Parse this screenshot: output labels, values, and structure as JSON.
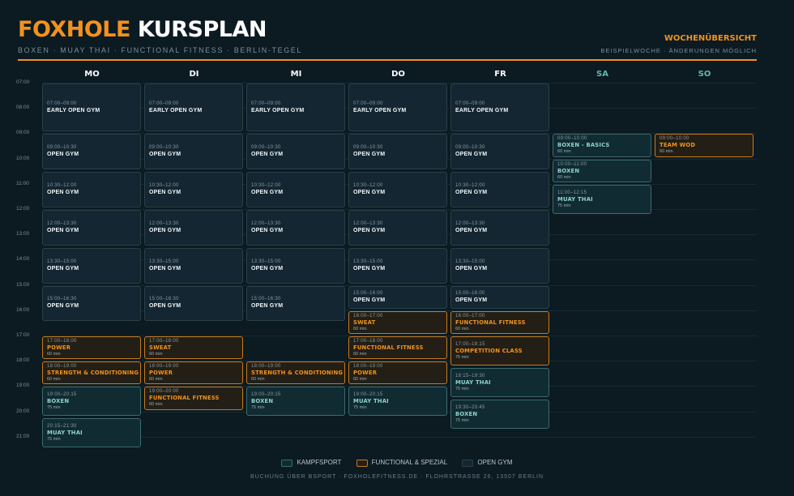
{
  "header": {
    "brand": "FOXHOLE",
    "title": "KURSPLAN",
    "subtitle": "BOXEN · MUAY THAI · FUNCTIONAL FITNESS · BERLIN-TEGEL",
    "overview": "WOCHENÜBERSICHT",
    "note": "BEISPIELWOCHE · ÄNDERUNGEN MÖGLICH"
  },
  "colors": {
    "accent": "#f2921d",
    "kampfsport": "#3a6c6c",
    "open_gym": "#2a4048",
    "background": "#0c1a22"
  },
  "days": [
    "MO",
    "DI",
    "MI",
    "DO",
    "FR",
    "SA",
    "SO"
  ],
  "times": [
    "07:00",
    "08:00",
    "09:00",
    "10:00",
    "11:00",
    "12:00",
    "13:00",
    "14:00",
    "15:00",
    "16:00",
    "17:00",
    "18:00",
    "19:00",
    "20:00",
    "21:00"
  ],
  "schedule": [
    [
      {
        "time": "07:00–09:00",
        "name": "EARLY OPEN GYM",
        "cat": "open",
        "start": 7,
        "end": 9
      },
      {
        "time": "09:00–10:30",
        "name": "OPEN GYM",
        "cat": "open",
        "start": 9,
        "end": 10.5
      },
      {
        "time": "10:30–12:00",
        "name": "OPEN GYM",
        "cat": "open",
        "start": 10.5,
        "end": 12
      },
      {
        "time": "12:00–13:30",
        "name": "OPEN GYM",
        "cat": "open",
        "start": 12,
        "end": 13.5
      },
      {
        "time": "13:30–15:00",
        "name": "OPEN GYM",
        "cat": "open",
        "start": 13.5,
        "end": 15
      },
      {
        "time": "15:00–16:30",
        "name": "OPEN GYM",
        "cat": "open",
        "start": 15,
        "end": 16.5
      },
      {
        "time": "17:00–18:00",
        "name": "POWER",
        "dur": "60 min",
        "cat": "fun",
        "start": 17,
        "end": 18
      },
      {
        "time": "18:00–19:00",
        "name": "STRENGTH & CONDITIONING",
        "dur": "60 min",
        "cat": "fun",
        "start": 18,
        "end": 19
      },
      {
        "time": "19:00–20:15",
        "name": "BOXEN",
        "dur": "75 min",
        "cat": "kampf",
        "start": 19,
        "end": 20.25
      },
      {
        "time": "20:15–21:30",
        "name": "MUAY THAI",
        "dur": "75 min",
        "cat": "kampf",
        "start": 20.25,
        "end": 21.5
      }
    ],
    [
      {
        "time": "07:00–09:00",
        "name": "EARLY OPEN GYM",
        "cat": "open",
        "start": 7,
        "end": 9
      },
      {
        "time": "09:00–10:30",
        "name": "OPEN GYM",
        "cat": "open",
        "start": 9,
        "end": 10.5
      },
      {
        "time": "10:30–12:00",
        "name": "OPEN GYM",
        "cat": "open",
        "start": 10.5,
        "end": 12
      },
      {
        "time": "12:00–13:30",
        "name": "OPEN GYM",
        "cat": "open",
        "start": 12,
        "end": 13.5
      },
      {
        "time": "13:30–15:00",
        "name": "OPEN GYM",
        "cat": "open",
        "start": 13.5,
        "end": 15
      },
      {
        "time": "15:00–16:30",
        "name": "OPEN GYM",
        "cat": "open",
        "start": 15,
        "end": 16.5
      },
      {
        "time": "17:00–18:00",
        "name": "SWEAT",
        "dur": "60 min",
        "cat": "fun",
        "start": 17,
        "end": 18
      },
      {
        "time": "18:00–19:00",
        "name": "POWER",
        "dur": "60 min",
        "cat": "fun",
        "start": 18,
        "end": 19
      },
      {
        "time": "19:00–20:00",
        "name": "FUNCTIONAL FITNESS",
        "dur": "60 min",
        "cat": "fun",
        "start": 19,
        "end": 20
      }
    ],
    [
      {
        "time": "07:00–09:00",
        "name": "EARLY OPEN GYM",
        "cat": "open",
        "start": 7,
        "end": 9
      },
      {
        "time": "09:00–10:30",
        "name": "OPEN GYM",
        "cat": "open",
        "start": 9,
        "end": 10.5
      },
      {
        "time": "10:30–12:00",
        "name": "OPEN GYM",
        "cat": "open",
        "start": 10.5,
        "end": 12
      },
      {
        "time": "12:00–13:30",
        "name": "OPEN GYM",
        "cat": "open",
        "start": 12,
        "end": 13.5
      },
      {
        "time": "13:30–15:00",
        "name": "OPEN GYM",
        "cat": "open",
        "start": 13.5,
        "end": 15
      },
      {
        "time": "15:00–16:30",
        "name": "OPEN GYM",
        "cat": "open",
        "start": 15,
        "end": 16.5
      },
      {
        "time": "18:00–19:00",
        "name": "STRENGTH & CONDITIONING",
        "dur": "60 min",
        "cat": "fun",
        "start": 18,
        "end": 19
      },
      {
        "time": "19:00–20:15",
        "name": "BOXEN",
        "dur": "75 min",
        "cat": "kampf",
        "start": 19,
        "end": 20.25
      }
    ],
    [
      {
        "time": "07:00–09:00",
        "name": "EARLY OPEN GYM",
        "cat": "open",
        "start": 7,
        "end": 9
      },
      {
        "time": "09:00–10:30",
        "name": "OPEN GYM",
        "cat": "open",
        "start": 9,
        "end": 10.5
      },
      {
        "time": "10:30–12:00",
        "name": "OPEN GYM",
        "cat": "open",
        "start": 10.5,
        "end": 12
      },
      {
        "time": "12:00–13:30",
        "name": "OPEN GYM",
        "cat": "open",
        "start": 12,
        "end": 13.5
      },
      {
        "time": "13:30–15:00",
        "name": "OPEN GYM",
        "cat": "open",
        "start": 13.5,
        "end": 15
      },
      {
        "time": "15:00–16:00",
        "name": "OPEN GYM",
        "cat": "open",
        "start": 15,
        "end": 16
      },
      {
        "time": "16:00–17:00",
        "name": "SWEAT",
        "dur": "60 min",
        "cat": "fun",
        "start": 16,
        "end": 17
      },
      {
        "time": "17:00–18:00",
        "name": "FUNCTIONAL FITNESS",
        "dur": "60 min",
        "cat": "fun",
        "start": 17,
        "end": 18
      },
      {
        "time": "18:00–19:00",
        "name": "POWER",
        "dur": "60 min",
        "cat": "fun",
        "start": 18,
        "end": 19
      },
      {
        "time": "19:00–20:15",
        "name": "MUAY THAI",
        "dur": "75 min",
        "cat": "kampf",
        "start": 19,
        "end": 20.25
      }
    ],
    [
      {
        "time": "07:00–09:00",
        "name": "EARLY OPEN GYM",
        "cat": "open",
        "start": 7,
        "end": 9
      },
      {
        "time": "09:00–10:30",
        "name": "OPEN GYM",
        "cat": "open",
        "start": 9,
        "end": 10.5
      },
      {
        "time": "10:30–12:00",
        "name": "OPEN GYM",
        "cat": "open",
        "start": 10.5,
        "end": 12
      },
      {
        "time": "12:00–13:30",
        "name": "OPEN GYM",
        "cat": "open",
        "start": 12,
        "end": 13.5
      },
      {
        "time": "13:30–15:00",
        "name": "OPEN GYM",
        "cat": "open",
        "start": 13.5,
        "end": 15
      },
      {
        "time": "15:00–16:00",
        "name": "OPEN GYM",
        "cat": "open",
        "start": 15,
        "end": 16
      },
      {
        "time": "16:00–17:00",
        "name": "FUNCTIONAL FITNESS",
        "dur": "60 min",
        "cat": "fun",
        "start": 16,
        "end": 17
      },
      {
        "time": "17:00–18:15",
        "name": "COMPETITION CLASS",
        "dur": "75 min",
        "cat": "fun",
        "start": 17,
        "end": 18.25
      },
      {
        "time": "18:15–19:30",
        "name": "MUAY THAI",
        "dur": "75 min",
        "cat": "kampf",
        "start": 18.25,
        "end": 19.5
      },
      {
        "time": "19:30–20:45",
        "name": "BOXEN",
        "dur": "75 min",
        "cat": "kampf",
        "start": 19.5,
        "end": 20.75
      }
    ],
    [
      {
        "time": "09:00–10:00",
        "name": "BOXEN - BASICS",
        "dur": "60 min",
        "cat": "kampf",
        "start": 9,
        "end": 10
      },
      {
        "time": "10:00–11:00",
        "name": "BOXEN",
        "dur": "60 min",
        "cat": "kampf",
        "start": 10,
        "end": 11
      },
      {
        "time": "11:00–12:15",
        "name": "MUAY THAI",
        "dur": "75 min",
        "cat": "kampf",
        "start": 11,
        "end": 12.25
      }
    ],
    [
      {
        "time": "09:00–10:00",
        "name": "TEAM WOD",
        "dur": "60 min",
        "cat": "fun",
        "start": 9,
        "end": 10
      }
    ]
  ],
  "legend": [
    {
      "label": "KAMPFSPORT",
      "cat": "kampf"
    },
    {
      "label": "FUNCTIONAL & SPEZIAL",
      "cat": "fun"
    },
    {
      "label": "OPEN GYM",
      "cat": "open"
    }
  ],
  "footer": "BUCHUNG ÜBER BSPORT · FOXHOLEFITNESS.DE · FLOHRSTRASSE 26, 13507 BERLIN"
}
